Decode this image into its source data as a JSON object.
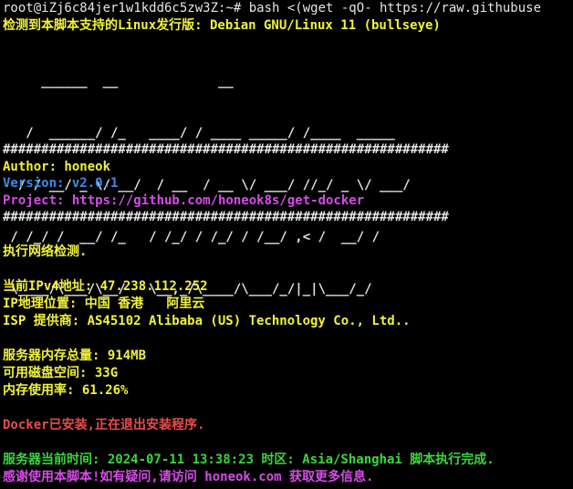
{
  "colors": {
    "background": "#000000",
    "white": "#e5e5e5",
    "yellow": "#f2f23a",
    "blue": "#3b8eea",
    "magenta": "#d64ce8",
    "red": "#e84c4c",
    "green": "#3bd63b"
  },
  "terminal": {
    "prompt": "root@iZj6c84jer1w1kdd6c5zw3Z:~# ",
    "command": "bash <(wget -qO- https://raw.githubuse",
    "detect_line": "检测到本脚本支持的Linux发行版: Debian GNU/Linux 11 (bullseye)",
    "ascii_art": [
      "     ______  __             __                ",
      "   /  ______/ /_   ____/ / ____ _____/ /____  _____",
      "  / / __/ _ \\/ __/  / __  / __ \\/ ___/ //_/ _ \\/ ___/",
      " / /_/ /  __/ /_   / /_/ / /_/ / /__/ ,< /  __/ /   ",
      " \\____/\\___/\\__/   \\__,_/\\____/\\___/_/|_|\\___/_/    "
    ],
    "separator": "##########################################################",
    "author": "Author: honeok",
    "version": "Version: v2.0.1",
    "project_label": "Project: ",
    "project_url": "https://github.com/honeok8s/get-docker",
    "network_check": "执行网络检测.",
    "ipv4": "当前IPv4地址: 47.238.112.252",
    "geo": "IP地理位置: 中国 香港   阿里云",
    "isp": "ISP 提供商: AS45102 Alibaba (US) Technology Co., Ltd..",
    "mem_total": "服务器内存总量: 914MB",
    "disk_free": "可用磁盘空间: 33G",
    "mem_usage": "内存使用率: 61.26%",
    "docker_status": "Docker已安装,正在退出安装程序.",
    "server_time": "服务器当前时间: 2024-07-11 13:38:23 时区: Asia/Shanghai 脚本执行完成.",
    "thanks": "感谢使用本脚本!如有疑问,请访问 honeok.com 获取更多信息."
  }
}
